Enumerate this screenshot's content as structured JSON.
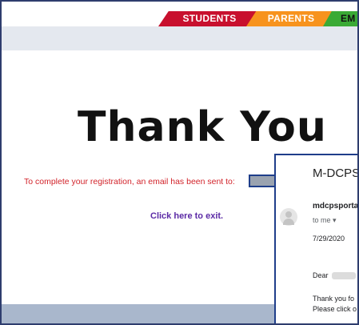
{
  "tabs": {
    "students": "STUDENTS",
    "parents": "PARENTS",
    "third": "EM"
  },
  "main": {
    "heading": "Thank You",
    "registration_text": "To complete your registration, an email has been sent to:",
    "exit_link": "Click here to exit."
  },
  "email": {
    "subject": "M-DCPS",
    "sender": "mdcpsporta",
    "recipient": "to me ▾",
    "date": "7/29/2020",
    "greeting": "Dear",
    "line1": "Thank you fo",
    "line2": "Please click o"
  },
  "colors": {
    "students_tab": "#c8102e",
    "parents_tab": "#f7931e",
    "third_tab": "#3aaa35",
    "registration_text": "#d2232a",
    "exit_link": "#5b2aa5"
  }
}
